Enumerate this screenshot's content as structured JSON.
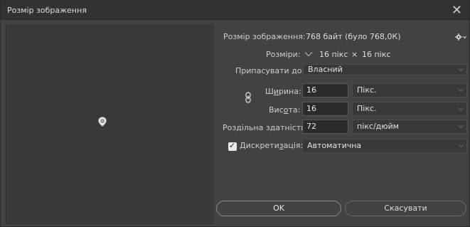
{
  "window": {
    "title": "Розмір зображення",
    "close_glyph": "✕"
  },
  "info": {
    "size_label": "Розмір зображення:",
    "size_value": "768 байт (було 768,0К)",
    "dims_label": "Розміри:",
    "dims_width": "16 пікс",
    "dims_sep": "×",
    "dims_height": "16 пікс"
  },
  "fit": {
    "label": "Припасувати до:",
    "value": "Власний"
  },
  "width": {
    "label_pre": "Ш",
    "label_ul": "и",
    "label_post": "рина:",
    "value": "16",
    "unit": "Пікс."
  },
  "height": {
    "label_pre": "Вис",
    "label_ul": "о",
    "label_post": "та:",
    "value": "16",
    "unit": "Пікс."
  },
  "resolution": {
    "label": "Роздільна здатність:",
    "value": "72",
    "unit": "пікс/дюйм"
  },
  "resample": {
    "checked": true,
    "label_pre": "Дискрети",
    "label_ul": "з",
    "label_post": "ація:",
    "value": "Автоматична"
  },
  "buttons": {
    "ok": "OK",
    "cancel": "Скасувати"
  },
  "icons": {
    "gear": "gear-icon",
    "link": "link-chain-icon",
    "dims_dropdown": "chevron-down-icon",
    "preview": "image-preview"
  },
  "colors": {
    "dialog_bg": "#424242",
    "titlebar_bg": "#323232",
    "field_bg": "#2b2b2b"
  }
}
